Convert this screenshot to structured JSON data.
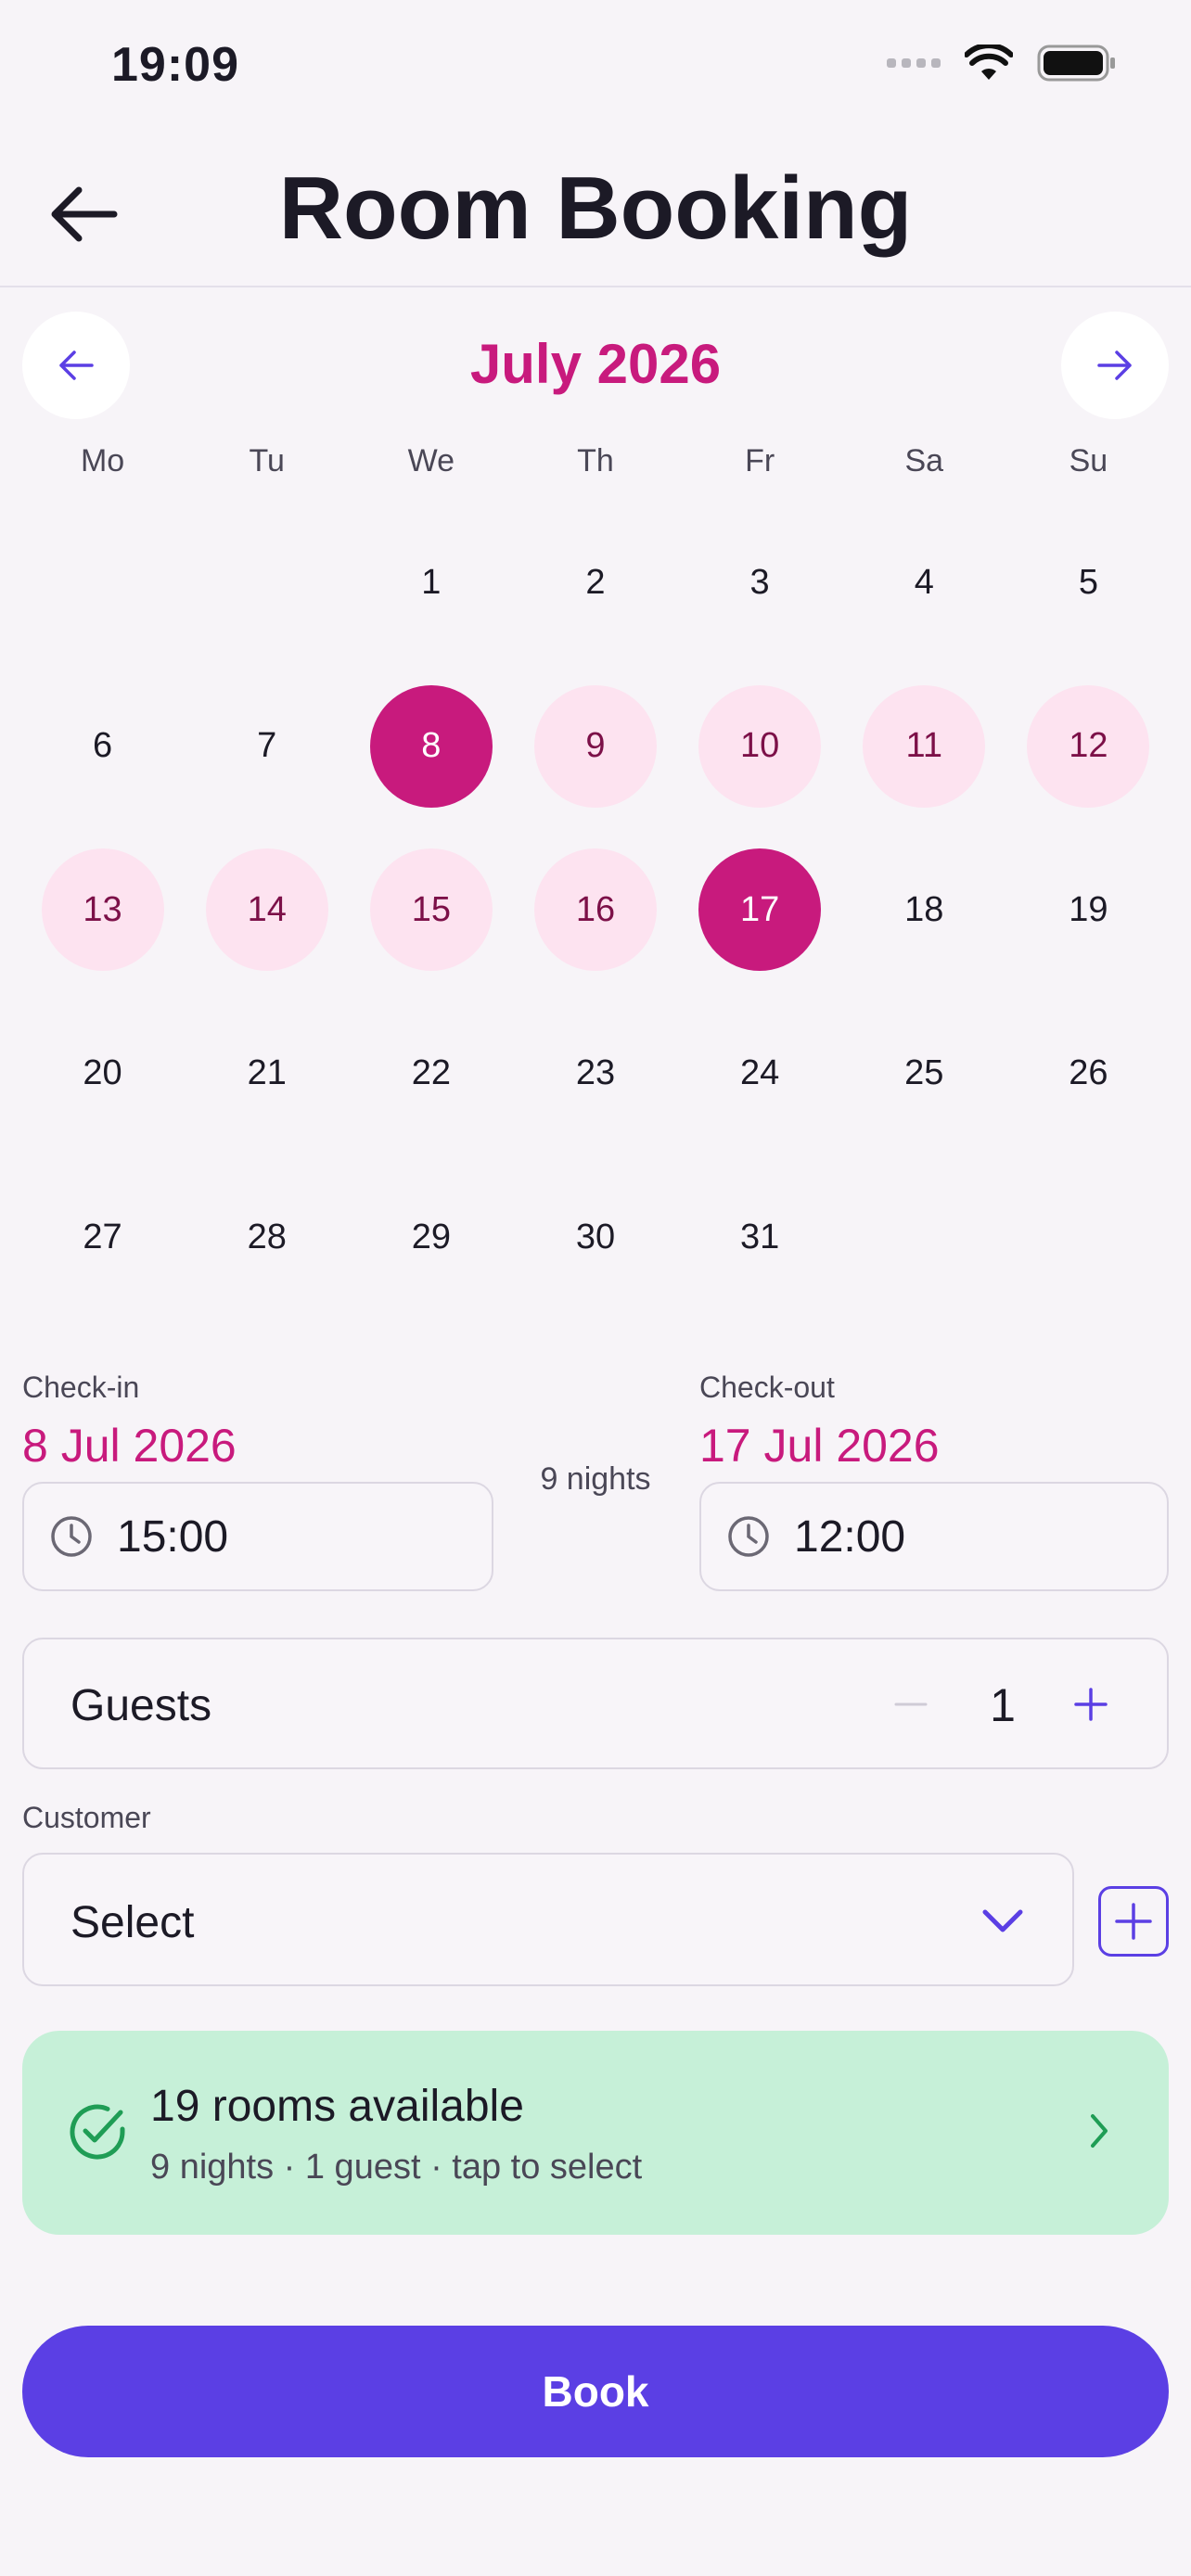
{
  "status_bar": {
    "time": "19:09"
  },
  "header": {
    "title": "Room Booking"
  },
  "calendar": {
    "month": "July 2026",
    "weekdays": [
      "Mo",
      "Tu",
      "We",
      "Th",
      "Fr",
      "Sa",
      "Su"
    ],
    "leading_blanks": 2,
    "days": [
      "1",
      "2",
      "3",
      "4",
      "5",
      "6",
      "7",
      "8",
      "9",
      "10",
      "11",
      "12",
      "13",
      "14",
      "15",
      "16",
      "17",
      "18",
      "19",
      "20",
      "21",
      "22",
      "23",
      "24",
      "25",
      "26",
      "27",
      "28",
      "29",
      "30",
      "31"
    ],
    "selected_start": 8,
    "selected_end": 17
  },
  "dates": {
    "checkin_label": "Check-in",
    "checkin_date": "8 Jul 2026",
    "checkin_time": "15:00",
    "checkout_label": "Check-out",
    "checkout_date": "17 Jul 2026",
    "checkout_time": "12:00",
    "nights": "9 nights"
  },
  "guests": {
    "label": "Guests",
    "count": "1"
  },
  "customer": {
    "label": "Customer",
    "value": "Select"
  },
  "availability": {
    "title": "19 rooms available",
    "subtitle": "9 nights · 1 guest · tap to select"
  },
  "book_button": "Book",
  "colors": {
    "accent": "#5b3fe4",
    "selection": "#c81a7d",
    "range": "#fde3f0",
    "success_bg": "#c6f0d8",
    "success_icon": "#1f9d55"
  }
}
